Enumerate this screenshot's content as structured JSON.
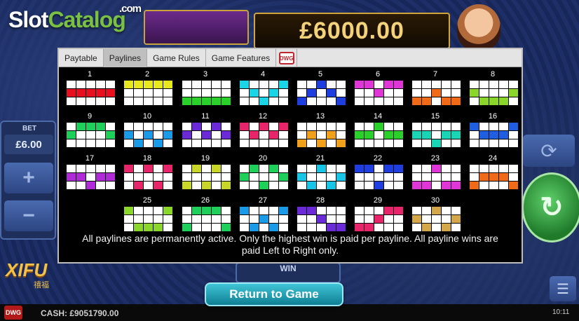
{
  "logo": {
    "slot": "Slot",
    "catalog": "Catalog",
    "com": ".com"
  },
  "jackpot": "£6000.00",
  "bet": {
    "label": "BET",
    "value": "£6.00",
    "plus": "+",
    "minus": "−"
  },
  "game_logo": {
    "title": "XIFU",
    "subtitle": "禧福"
  },
  "win": {
    "label": "WIN"
  },
  "return_button": "Return to Game",
  "cash": "CASH: £9051790.00",
  "clock": "10:11",
  "tabs": [
    {
      "label": "Paytable",
      "active": false
    },
    {
      "label": "Paylines",
      "active": true
    },
    {
      "label": "Game Rules",
      "active": false
    },
    {
      "label": "Game Features",
      "active": false
    }
  ],
  "brand_icon": "DWG",
  "icons": {
    "refresh": "refresh-icon",
    "spin": "spin-arrow-icon",
    "menu": "menu-icon"
  },
  "paylines": [
    {
      "n": "1",
      "color": "#e8101e",
      "rows": [
        1,
        1,
        1,
        1,
        1
      ]
    },
    {
      "n": "2",
      "color": "#e8e81e",
      "rows": [
        0,
        0,
        0,
        0,
        0
      ]
    },
    {
      "n": "3",
      "color": "#2ad12a",
      "rows": [
        2,
        2,
        2,
        2,
        2
      ]
    },
    {
      "n": "4",
      "color": "#19d5e6",
      "rows": [
        0,
        1,
        2,
        1,
        0
      ]
    },
    {
      "n": "5",
      "color": "#1f3ee0",
      "rows": [
        2,
        1,
        0,
        1,
        2
      ]
    },
    {
      "n": "6",
      "color": "#e036d8",
      "rows": [
        0,
        0,
        1,
        0,
        0
      ]
    },
    {
      "n": "7",
      "color": "#f06a18",
      "rows": [
        2,
        2,
        1,
        2,
        2
      ]
    },
    {
      "n": "8",
      "color": "#8ad62a",
      "rows": [
        1,
        2,
        2,
        2,
        1
      ]
    },
    {
      "n": "9",
      "color": "#1ed05a",
      "rows": [
        1,
        0,
        0,
        0,
        1
      ]
    },
    {
      "n": "10",
      "color": "#1a9be8",
      "rows": [
        1,
        2,
        1,
        2,
        1
      ]
    },
    {
      "n": "11",
      "color": "#6a2ad8",
      "rows": [
        1,
        0,
        1,
        0,
        1
      ]
    },
    {
      "n": "12",
      "color": "#e8246a",
      "rows": [
        0,
        1,
        0,
        1,
        0
      ]
    },
    {
      "n": "13",
      "color": "#f0a01a",
      "rows": [
        2,
        1,
        2,
        1,
        2
      ]
    },
    {
      "n": "14",
      "color": "#2ad12a",
      "rows": [
        1,
        1,
        0,
        1,
        1
      ]
    },
    {
      "n": "15",
      "color": "#19d5b6",
      "rows": [
        1,
        1,
        2,
        1,
        1
      ]
    },
    {
      "n": "16",
      "color": "#1f5ee0",
      "rows": [
        0,
        1,
        1,
        1,
        0
      ]
    },
    {
      "n": "17",
      "color": "#b02ad8",
      "rows": [
        1,
        1,
        2,
        1,
        1
      ]
    },
    {
      "n": "18",
      "color": "#e8246a",
      "rows": [
        0,
        2,
        0,
        2,
        0
      ]
    },
    {
      "n": "19",
      "color": "#c8d62a",
      "rows": [
        2,
        0,
        2,
        0,
        2
      ]
    },
    {
      "n": "20",
      "color": "#1ed05a",
      "rows": [
        1,
        0,
        2,
        0,
        1
      ]
    },
    {
      "n": "21",
      "color": "#19c5e6",
      "rows": [
        1,
        2,
        0,
        2,
        1
      ]
    },
    {
      "n": "22",
      "color": "#1f3ee0",
      "rows": [
        0,
        0,
        2,
        0,
        0
      ]
    },
    {
      "n": "23",
      "color": "#e036d8",
      "rows": [
        2,
        2,
        0,
        2,
        2
      ]
    },
    {
      "n": "24",
      "color": "#f06a18",
      "rows": [
        2,
        1,
        1,
        1,
        2
      ]
    },
    {
      "n": "25",
      "color": "#8ad62a",
      "rows": [
        0,
        2,
        2,
        2,
        0
      ]
    },
    {
      "n": "26",
      "color": "#1ed05a",
      "rows": [
        2,
        0,
        0,
        0,
        2
      ]
    },
    {
      "n": "27",
      "color": "#1a9be8",
      "rows": [
        0,
        2,
        1,
        2,
        0
      ]
    },
    {
      "n": "28",
      "color": "#6a2ad8",
      "rows": [
        0,
        0,
        1,
        2,
        2
      ]
    },
    {
      "n": "29",
      "color": "#e8246a",
      "rows": [
        2,
        2,
        1,
        0,
        0
      ]
    },
    {
      "n": "30",
      "color": "#d4a84a",
      "rows": [
        1,
        2,
        0,
        2,
        1
      ]
    }
  ],
  "footnote": "All paylines are permanently active. Only the highest win is paid per payline. All payline wins are paid Left to Right only."
}
